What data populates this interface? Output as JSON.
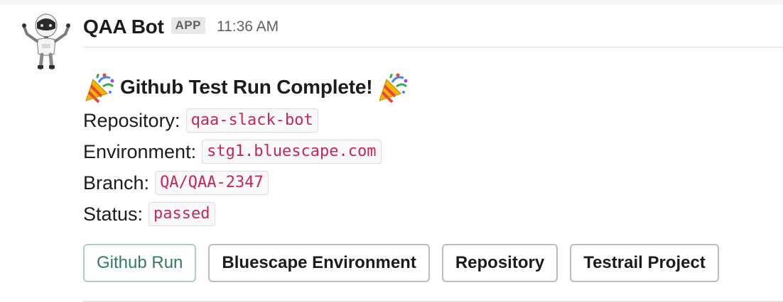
{
  "message": {
    "bot_name": "QAA Bot",
    "badge": "APP",
    "timestamp": "11:36 AM",
    "avatar_icon": "robot-avatar-icon",
    "title": "Github Test Run Complete!",
    "title_icon": "party-popper-icon",
    "fields": [
      {
        "label": "Repository:",
        "value": "qaa-slack-bot"
      },
      {
        "label": "Environment:",
        "value": "stg1.bluescape.com"
      },
      {
        "label": "Branch:",
        "value": "QA/QAA-2347"
      },
      {
        "label": "Status:",
        "value": "passed"
      }
    ]
  },
  "actions": [
    {
      "label": "Github Run",
      "style": "primary"
    },
    {
      "label": "Bluescape Environment",
      "style": "default"
    },
    {
      "label": "Repository",
      "style": "default"
    },
    {
      "label": "Testrail Project",
      "style": "default"
    }
  ],
  "colors": {
    "code_text": "#c42857",
    "primary_button_text": "#2e7d5c",
    "primary_button_border": "#a9d1bf"
  }
}
